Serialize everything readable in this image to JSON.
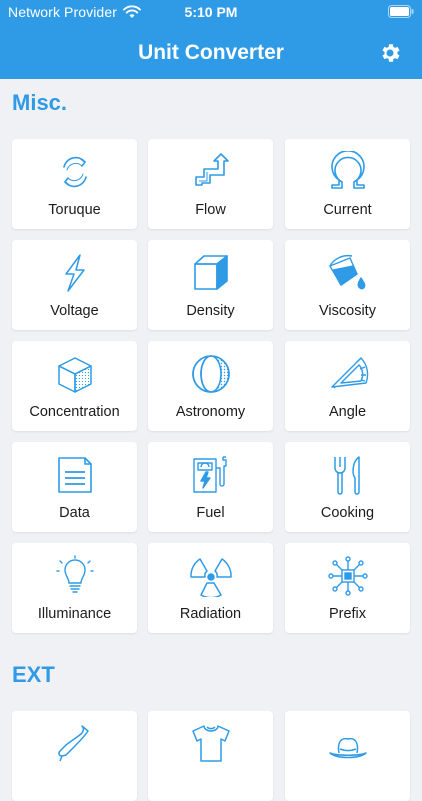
{
  "status_bar": {
    "carrier": "Network Provider",
    "time": "5:10 PM"
  },
  "header": {
    "title": "Unit Converter"
  },
  "sections": [
    {
      "title": "Misc.",
      "items": [
        {
          "label": "Toruque",
          "icon": "torque-rotate-icon"
        },
        {
          "label": "Flow",
          "icon": "flow-pipe-icon"
        },
        {
          "label": "Current",
          "icon": "omega-icon"
        },
        {
          "label": "Voltage",
          "icon": "lightning-icon"
        },
        {
          "label": "Density",
          "icon": "cube-icon"
        },
        {
          "label": "Viscosity",
          "icon": "paint-bucket-icon"
        },
        {
          "label": "Concentration",
          "icon": "dotted-cube-icon"
        },
        {
          "label": "Astronomy",
          "icon": "moon-icon"
        },
        {
          "label": "Angle",
          "icon": "protractor-icon"
        },
        {
          "label": "Data",
          "icon": "document-icon"
        },
        {
          "label": "Fuel",
          "icon": "fuel-pump-icon"
        },
        {
          "label": "Cooking",
          "icon": "fork-knife-icon"
        },
        {
          "label": "Illuminance",
          "icon": "light-bulb-icon"
        },
        {
          "label": "Radiation",
          "icon": "radiation-icon"
        },
        {
          "label": "Prefix",
          "icon": "network-node-icon"
        }
      ]
    },
    {
      "title": "EXT",
      "items": [
        {
          "label": "",
          "icon": "shoe-icon"
        },
        {
          "label": "",
          "icon": "shirt-icon"
        },
        {
          "label": "",
          "icon": "hat-icon"
        }
      ]
    }
  ],
  "colors": {
    "accent": "#2f9be6",
    "background": "#f0f1f5",
    "card": "#ffffff",
    "label": "#1c1c1c"
  }
}
